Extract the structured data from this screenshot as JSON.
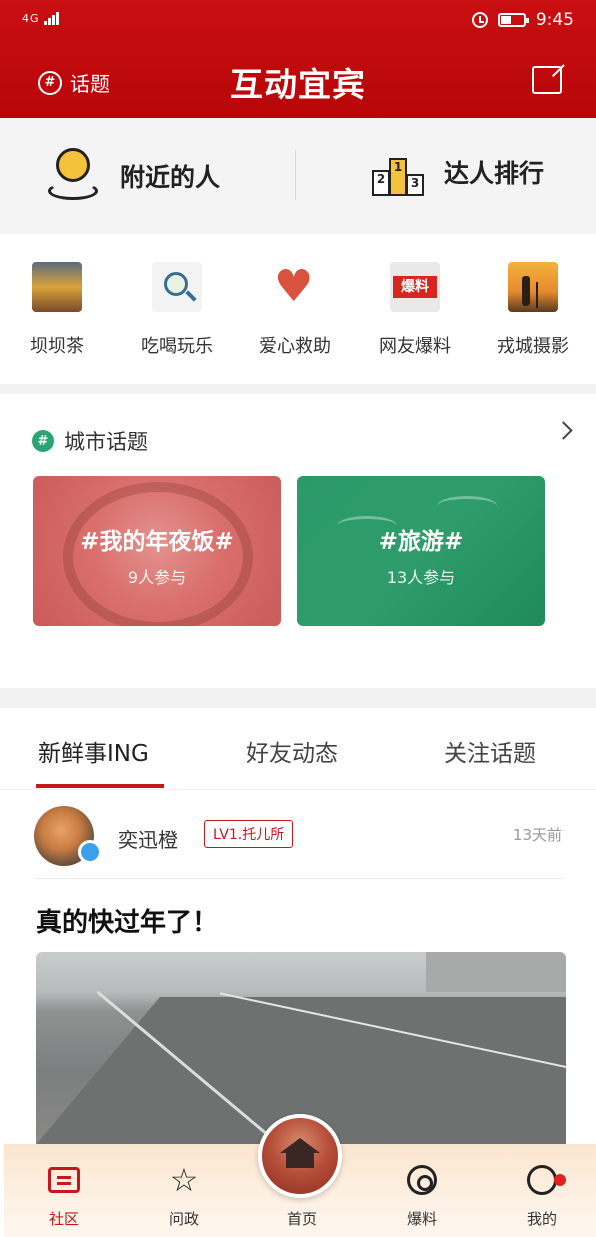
{
  "status_bar": {
    "signal": "4G",
    "time": "9:45"
  },
  "header": {
    "topic_label": "话题",
    "title": "互动宜宾"
  },
  "nearby": {
    "people": "附近的人",
    "ranking": "达人排行"
  },
  "categories": [
    {
      "label": "坝坝茶"
    },
    {
      "label": "吃喝玩乐"
    },
    {
      "label": "爱心救助"
    },
    {
      "label": "网友爆料",
      "thumb_text": "爆料"
    },
    {
      "label": "戎城摄影"
    }
  ],
  "city_topics": {
    "heading": "城市话题",
    "cards": [
      {
        "title": "#我的年夜饭#",
        "participants": "9人参与",
        "color": "#d96e6b"
      },
      {
        "title": "#旅游#",
        "participants": "13人参与",
        "color": "#2b9a69"
      }
    ]
  },
  "tabs": [
    {
      "label": "新鲜事ING",
      "active": true
    },
    {
      "label": "好友动态"
    },
    {
      "label": "关注话题"
    }
  ],
  "post": {
    "username": "奕迅橙",
    "level": "LV1.托儿所",
    "time": "13天前",
    "title": "真的快过年了！"
  },
  "bottom_nav": [
    {
      "label": "社区",
      "icon": "chat-icon",
      "active": true
    },
    {
      "label": "问政",
      "icon": "star-icon"
    },
    {
      "label": "首页",
      "icon": "home-icon"
    },
    {
      "label": "爆料",
      "icon": "hook-icon"
    },
    {
      "label": "我的",
      "icon": "profile-icon"
    }
  ],
  "colors": {
    "brand": "#c8161d",
    "topic_green": "#27a572"
  }
}
